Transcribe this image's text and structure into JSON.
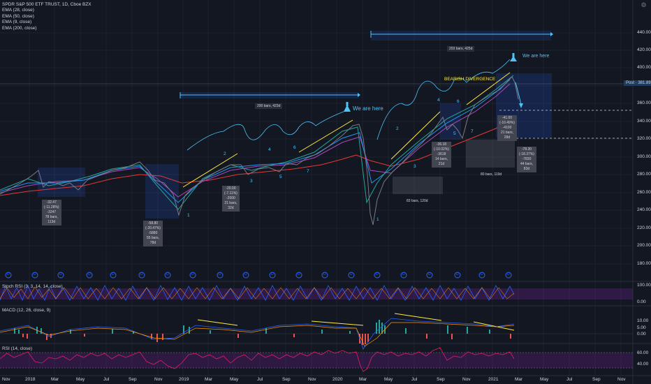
{
  "legend": {
    "symbol": "SPDR S&P 500 ETF TRUST, 1D, Cboe BZX",
    "ema28": "EMA (28, close)",
    "ema50": "EMA (50, close)",
    "ema9": "EMA (9, close)",
    "ema200": "EMA (200, close)"
  },
  "price_scale": {
    "ticks": [
      "440.00",
      "420.00",
      "400.00",
      "380.00",
      "360.00",
      "340.00",
      "320.00",
      "300.00",
      "280.00",
      "260.00",
      "240.00",
      "220.00",
      "200.00",
      "180.00"
    ],
    "current_label": "Post · 381.89",
    "current_color": "#1e3a5f"
  },
  "stoch": {
    "label": "Stoch RSI (3, 3, 14, 14, close)",
    "ticks": [
      "100.00",
      "0.00"
    ]
  },
  "macd": {
    "label": "MACD (12, 26, close, 9)",
    "ticks": [
      "10.00",
      "5.00",
      "0.00"
    ]
  },
  "rsi": {
    "label": "RSI (14, close)",
    "ticks": [
      "60.00",
      "40.00"
    ]
  },
  "time_axis": [
    "Nov",
    "2018",
    "Mar",
    "May",
    "Jul",
    "Sep",
    "Nov",
    "2019",
    "Mar",
    "May",
    "Jul",
    "Sep",
    "Nov",
    "2020",
    "Mar",
    "May",
    "Jul",
    "Sep",
    "Nov",
    "2021",
    "Mar",
    "May",
    "Jul",
    "Sep",
    "Nov"
  ],
  "annotations": {
    "bars_200_423": "200 bars, 423d",
    "bars_203_425": "203 bars, 425d",
    "we_are_here_1": "We are here",
    "we_are_here_2": "We are here",
    "bearish_divergence": "BEARISH DIVERGENCE",
    "m1_line1": "-32.47 (-11.28%) -3247",
    "m1_line2": "78 bars, 113d",
    "m2_line1": "-58.80 (-20.47%) -5880",
    "m2_line2": "55 bars, 78d",
    "m3_line1": "-20.00 (-7.11%) -2000",
    "m3_line2": "21 bars, 32d",
    "m4_line1": "-36.18 (-10.02%) -3618",
    "m4_line2": "14 bars, 21d",
    "m5_line1": "-41.00 (-10.49%) -4100",
    "m5_line2": "21 bars, 28d",
    "m6_line1": "-78.30 (-18.37%) -7830",
    "m6_line2": "44 bars, 83d",
    "bars_83_120": "83 bars, 120d",
    "bars_80_119": "80 bars, 119d"
  },
  "wave_labels": [
    "1",
    "2",
    "3",
    "4",
    "5",
    "6",
    "7",
    "1",
    "2",
    "3",
    "4",
    "5",
    "6",
    "7"
  ],
  "event_marker": "D",
  "colors": {
    "price": "#787b86",
    "ema_red": "#e53935",
    "ema_purple": "#ab47bc",
    "ema_blue": "#2196f3",
    "ema_teal": "#26a69a",
    "annotation_blue": "#4fc3f7",
    "trend_yellow": "#ffeb3b",
    "macd_hist_green": "#26a69a",
    "macd_hist_red": "#ef5350",
    "rsi_line": "#e91e63"
  }
}
